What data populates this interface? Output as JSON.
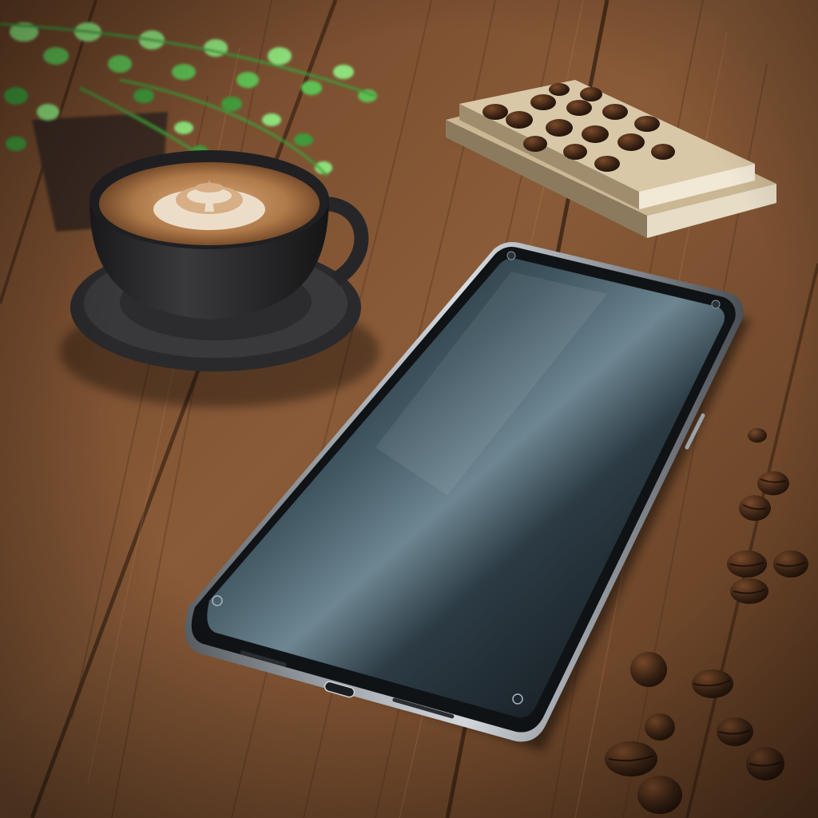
{
  "scene": {
    "description_elements": [
      "wooden-table",
      "potted-fern",
      "latte-cup",
      "saucer",
      "book-stack",
      "coffee-beans",
      "smartphone"
    ]
  },
  "palette": {
    "wood_light": "#9a6a44",
    "wood_mid": "#7a4f30",
    "wood_dark": "#4e301b",
    "plank_seam": "#2e1b0e",
    "leaf_light": "#8ee07a",
    "leaf_dark": "#3f9a3a",
    "pot": "#3a2a22",
    "cup": "#2b2b2d",
    "latte": "#b07a4a",
    "foam": "#efe2cf",
    "book_cover": "#d9c8a8",
    "bean": "#3a2314",
    "phone_body": "#101316",
    "phone_screen": "#1c2a33",
    "phone_rim": "#b9c0c6"
  },
  "phone": {
    "screen_state": "off"
  }
}
